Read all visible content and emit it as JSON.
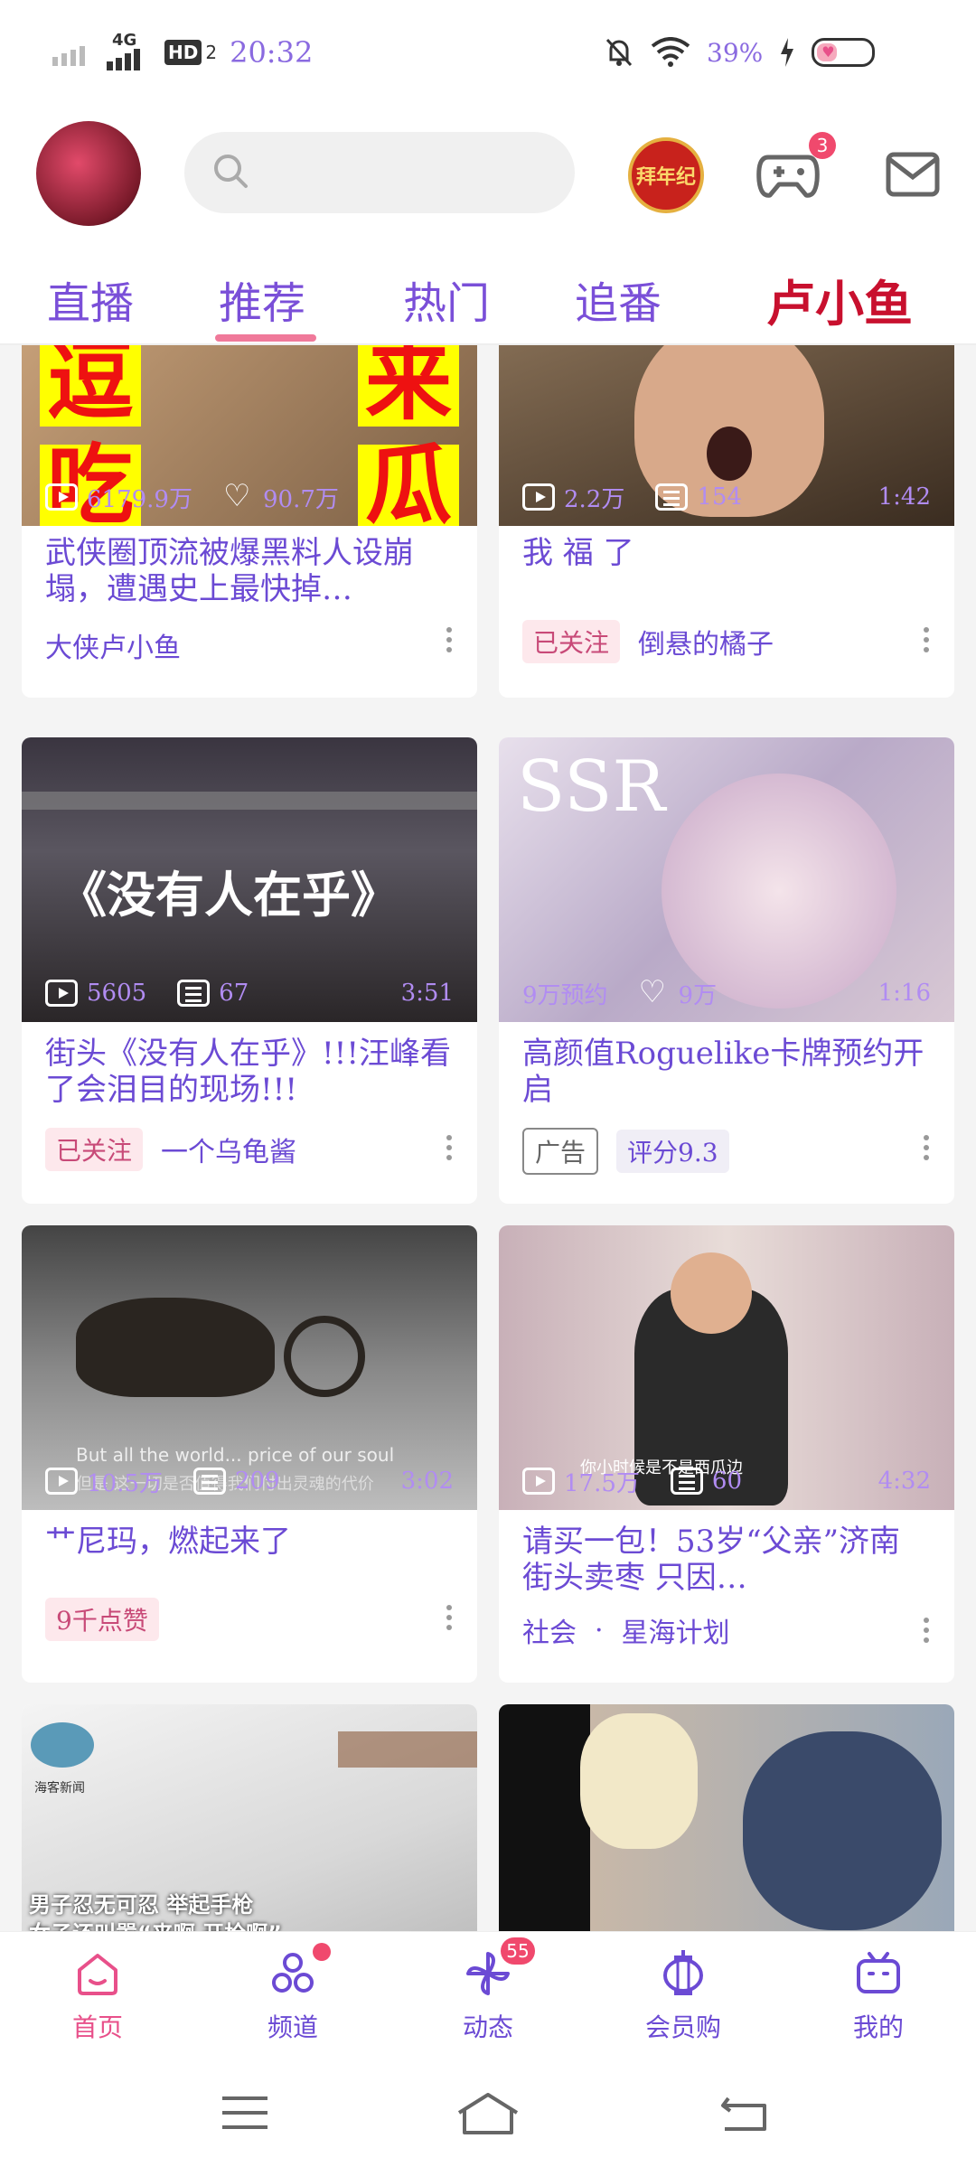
{
  "status": {
    "net1": "4G",
    "net2": "HD",
    "net2_sub": "2",
    "time": "20:32",
    "battery": "39%"
  },
  "topbar": {
    "search_placeholder": "",
    "new_year_badge": "拜年纪",
    "game_badge_count": "3"
  },
  "tabs": {
    "items": [
      "直播",
      "推荐",
      "热门",
      "追番"
    ],
    "active": "推荐",
    "brand": "卢小鱼"
  },
  "cards": [
    {
      "thumb_text": [
        "逗",
        "来",
        "吃",
        "瓜"
      ],
      "plays": "6179.9万",
      "likes": "90.7万",
      "duration": "",
      "title": "武侠圈顶流被爆黑料人设崩塌，遭遇史上最快掉…",
      "author": "大侠卢小鱼"
    },
    {
      "plays": "2.2万",
      "comments": "154",
      "duration": "1:42",
      "title": "我 福 了",
      "tag": "已关注",
      "author": "倒悬的橘子"
    },
    {
      "thumb_text": "《没有人在乎》",
      "plays": "5605",
      "comments": "67",
      "duration": "3:51",
      "title": "街头《没有人在乎》!!!汪峰看了会泪目的现场!!!",
      "tag": "已关注",
      "author": "一个乌龟酱"
    },
    {
      "thumb_text": "SSR",
      "plays": "9万预约",
      "likes": "9万",
      "duration": "1:16",
      "title": "高颜值Roguelike卡牌预约开启",
      "tag": "广告",
      "rating": "评分9.3"
    },
    {
      "thumb_sub1": "But all the world... price of our soul",
      "thumb_sub2": "但是 这一切是否值得我们付出灵魂的代价",
      "plays": "10.5万",
      "comments": "209",
      "duration": "3:02",
      "title": "艹尼玛，燃起来了",
      "tag": "9千点赞"
    },
    {
      "thumb_sub": "你小时候是不是西瓜边",
      "plays": "17.5万",
      "comments": "60",
      "duration": "4:32",
      "title": "请买一包！53岁“父亲”济南街头卖枣 只因…",
      "category": "社会",
      "author": "星海计划"
    },
    {
      "thumb_label": "海客新闻",
      "thumb_caption1": "男子忍无可忍 举起手枪",
      "thumb_caption2": "女子还叫嚣“来啊 开枪啊”"
    },
    {}
  ],
  "nav": {
    "items": [
      "首页",
      "频道",
      "动态",
      "会员购",
      "我的"
    ],
    "active": "首页",
    "dynamic_count": "55"
  },
  "colors": {
    "accent": "#f0799a",
    "text": "#6b4ad4",
    "badge": "#f0496d"
  }
}
